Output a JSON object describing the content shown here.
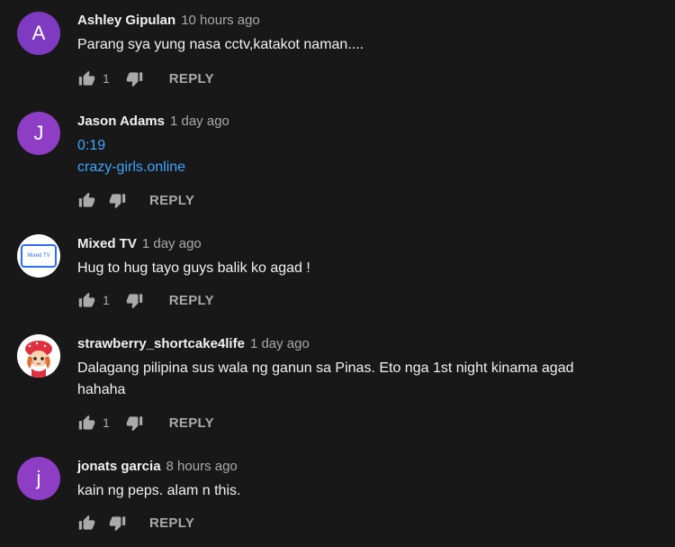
{
  "comments": [
    {
      "author": "Ashley Gipulan",
      "time": "10 hours ago",
      "avatar_letter": "A",
      "avatar_color": "#7e3ac1",
      "lines": [
        "Parang sya yung nasa cctv,katakot naman...."
      ],
      "likes": "1",
      "reply_label": "REPLY"
    },
    {
      "author": "Jason Adams",
      "time": "1 day ago",
      "avatar_letter": "J",
      "avatar_color": "#8e3ec4",
      "links": [
        "0:19",
        "crazy-girls.online"
      ],
      "likes": "",
      "reply_label": "REPLY"
    },
    {
      "author": "Mixed TV",
      "time": "1 day ago",
      "avatar_logo": "Mixed TV",
      "lines": [
        "Hug to hug tayo guys balik ko agad !"
      ],
      "likes": "1",
      "reply_label": "REPLY"
    },
    {
      "author": "strawberry_shortcake4life",
      "time": "1 day ago",
      "lines": [
        "Dalagang pilipina sus wala ng ganun sa Pinas. Eto nga 1st night kinama agad",
        "hahaha"
      ],
      "likes": "1",
      "reply_label": "REPLY"
    },
    {
      "author": "jonats garcia",
      "time": "8 hours ago",
      "avatar_letter": "j",
      "avatar_color": "#8e3ec4",
      "lines": [
        "kain ng peps. alam n this."
      ],
      "likes": "",
      "reply_label": "REPLY"
    }
  ],
  "icons": {
    "like": "thumbs-up-icon",
    "dislike": "thumbs-down-icon"
  }
}
